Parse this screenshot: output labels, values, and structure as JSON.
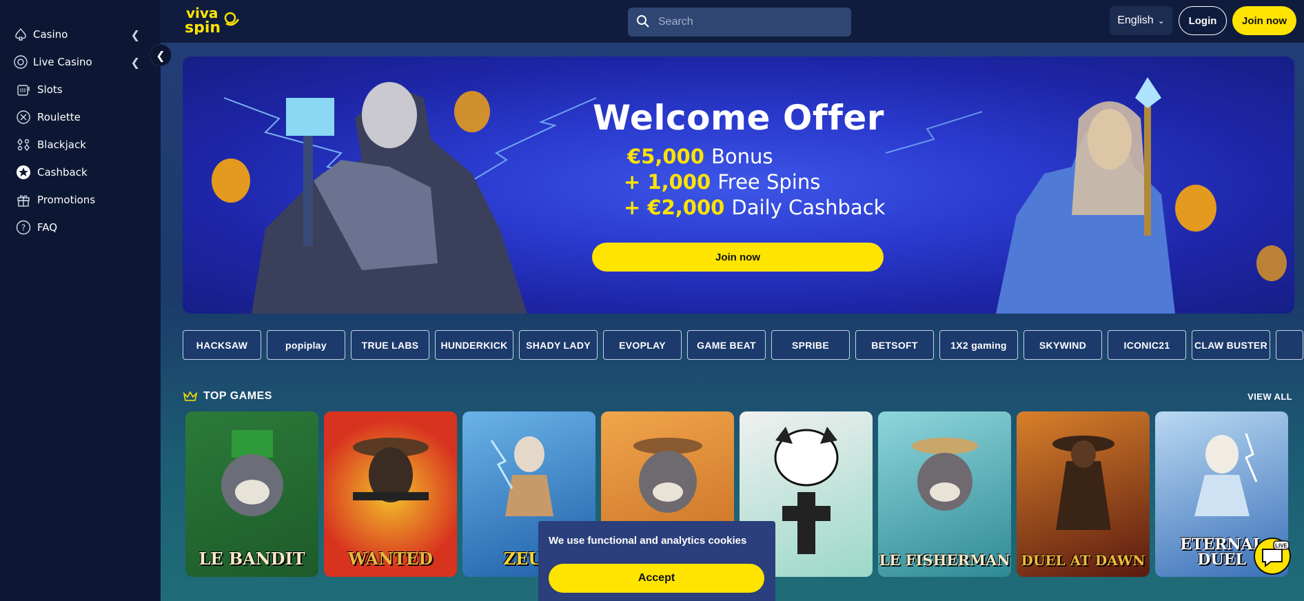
{
  "colors": {
    "accent": "#ffe400",
    "sidebar": "#0c1833",
    "header": "#0f1c3d",
    "hero": "#2b3bd0"
  },
  "sidebar": {
    "items": [
      {
        "label": "Casino",
        "icon": "spade-icon",
        "expandable": true
      },
      {
        "label": "Live Casino",
        "icon": "chip-icon",
        "expandable": true
      },
      {
        "label": "Slots",
        "icon": "slot-machine-icon"
      },
      {
        "label": "Roulette",
        "icon": "roulette-icon"
      },
      {
        "label": "Blackjack",
        "icon": "cards-icon"
      },
      {
        "label": "Cashback",
        "icon": "star-badge-icon"
      },
      {
        "label": "Promotions",
        "icon": "gift-icon"
      },
      {
        "label": "FAQ",
        "icon": "question-icon"
      }
    ]
  },
  "header": {
    "logo_text": "viva spin",
    "search_placeholder": "Search",
    "language": "English",
    "login_label": "Login",
    "join_label": "Join now"
  },
  "hero": {
    "title": "Welcome Offer",
    "line1_highlight": "€5,000",
    "line1_text": "Bonus",
    "line2_highlight": "+ 1,000",
    "line2_text": "Free Spins",
    "line3_highlight": "+ €2,000",
    "line3_text": "Daily Cashback",
    "button_label": "Join now"
  },
  "providers": [
    "HACKSAW",
    "popiplay",
    "TRUE LABS",
    "HUNDERKICK",
    "SHADY LADY",
    "EVOPLAY",
    "GAME BEAT",
    "SPRIBE",
    "BETSOFT",
    "1X2 gaming",
    "SKYWIND",
    "ICONIC21",
    "CLAW BUSTER"
  ],
  "top_games": {
    "title": "TOP GAMES",
    "view_all": "VIEW ALL",
    "games": [
      {
        "title": "LE BANDIT",
        "bg": "#2c7a3a"
      },
      {
        "title": "WANTED",
        "bg": "#c0392b"
      },
      {
        "title": "ZEUS",
        "bg": "#2f6fb8"
      },
      {
        "title": "",
        "bg": "#e0862e"
      },
      {
        "title": "",
        "bg": "#d8d8d8"
      },
      {
        "title": "LE FISHERMAN",
        "bg": "#3aa0a8"
      },
      {
        "title": "DUEL AT DAWN",
        "bg": "#8a2a1a"
      },
      {
        "title": "ETERNAL DUEL",
        "bg": "#4b7fc4"
      }
    ]
  },
  "cookie": {
    "message": "We use functional and analytics cookies",
    "accept_label": "Accept"
  },
  "chat": {
    "badge": "LIVE"
  }
}
